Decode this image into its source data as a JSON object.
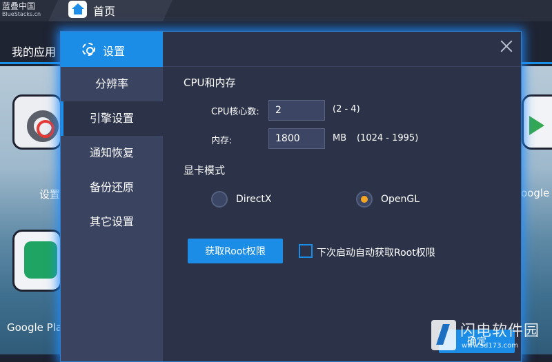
{
  "topbar": {
    "brand_cn": "蓝叠中国",
    "brand_en": "BlueStacks.cn",
    "home_tab_label": "首页"
  },
  "subbar": {
    "my_apps_label": "我的应用"
  },
  "background_apps": [
    {
      "label": "设置"
    },
    {
      "label": "Google Pla"
    },
    {
      "label": "oogle"
    }
  ],
  "dialog": {
    "title": "设置",
    "sidebar_items": [
      {
        "label": "分辨率"
      },
      {
        "label": "引擎设置"
      },
      {
        "label": "通知恢复"
      },
      {
        "label": "备份还原"
      },
      {
        "label": "其它设置"
      }
    ],
    "active_index": 1,
    "cpu_section_title": "CPU和内存",
    "cpu_cores": {
      "label": "CPU核心数:",
      "value": "2",
      "hint": "(2 - 4)"
    },
    "memory": {
      "label": "内存:",
      "value": "1800",
      "unit": "MB",
      "hint": "(1024 - 1995)"
    },
    "gpu_section_title": "显卡模式",
    "gpu_options": [
      {
        "label": "DirectX",
        "checked": false
      },
      {
        "label": "OpenGL",
        "checked": true
      }
    ],
    "root_button_label": "获取Root权限",
    "auto_root_checkbox_label": "下次启动自动获取Root权限",
    "confirm_button_label": "确定"
  },
  "watermark": {
    "name": "闪电软件园",
    "url": "www.sd173.com"
  },
  "colors": {
    "accent": "#1c8de6",
    "dialog_bg": "#2c3349",
    "sidebar_bg": "#3a4360",
    "radio_checked": "#f5a623"
  }
}
